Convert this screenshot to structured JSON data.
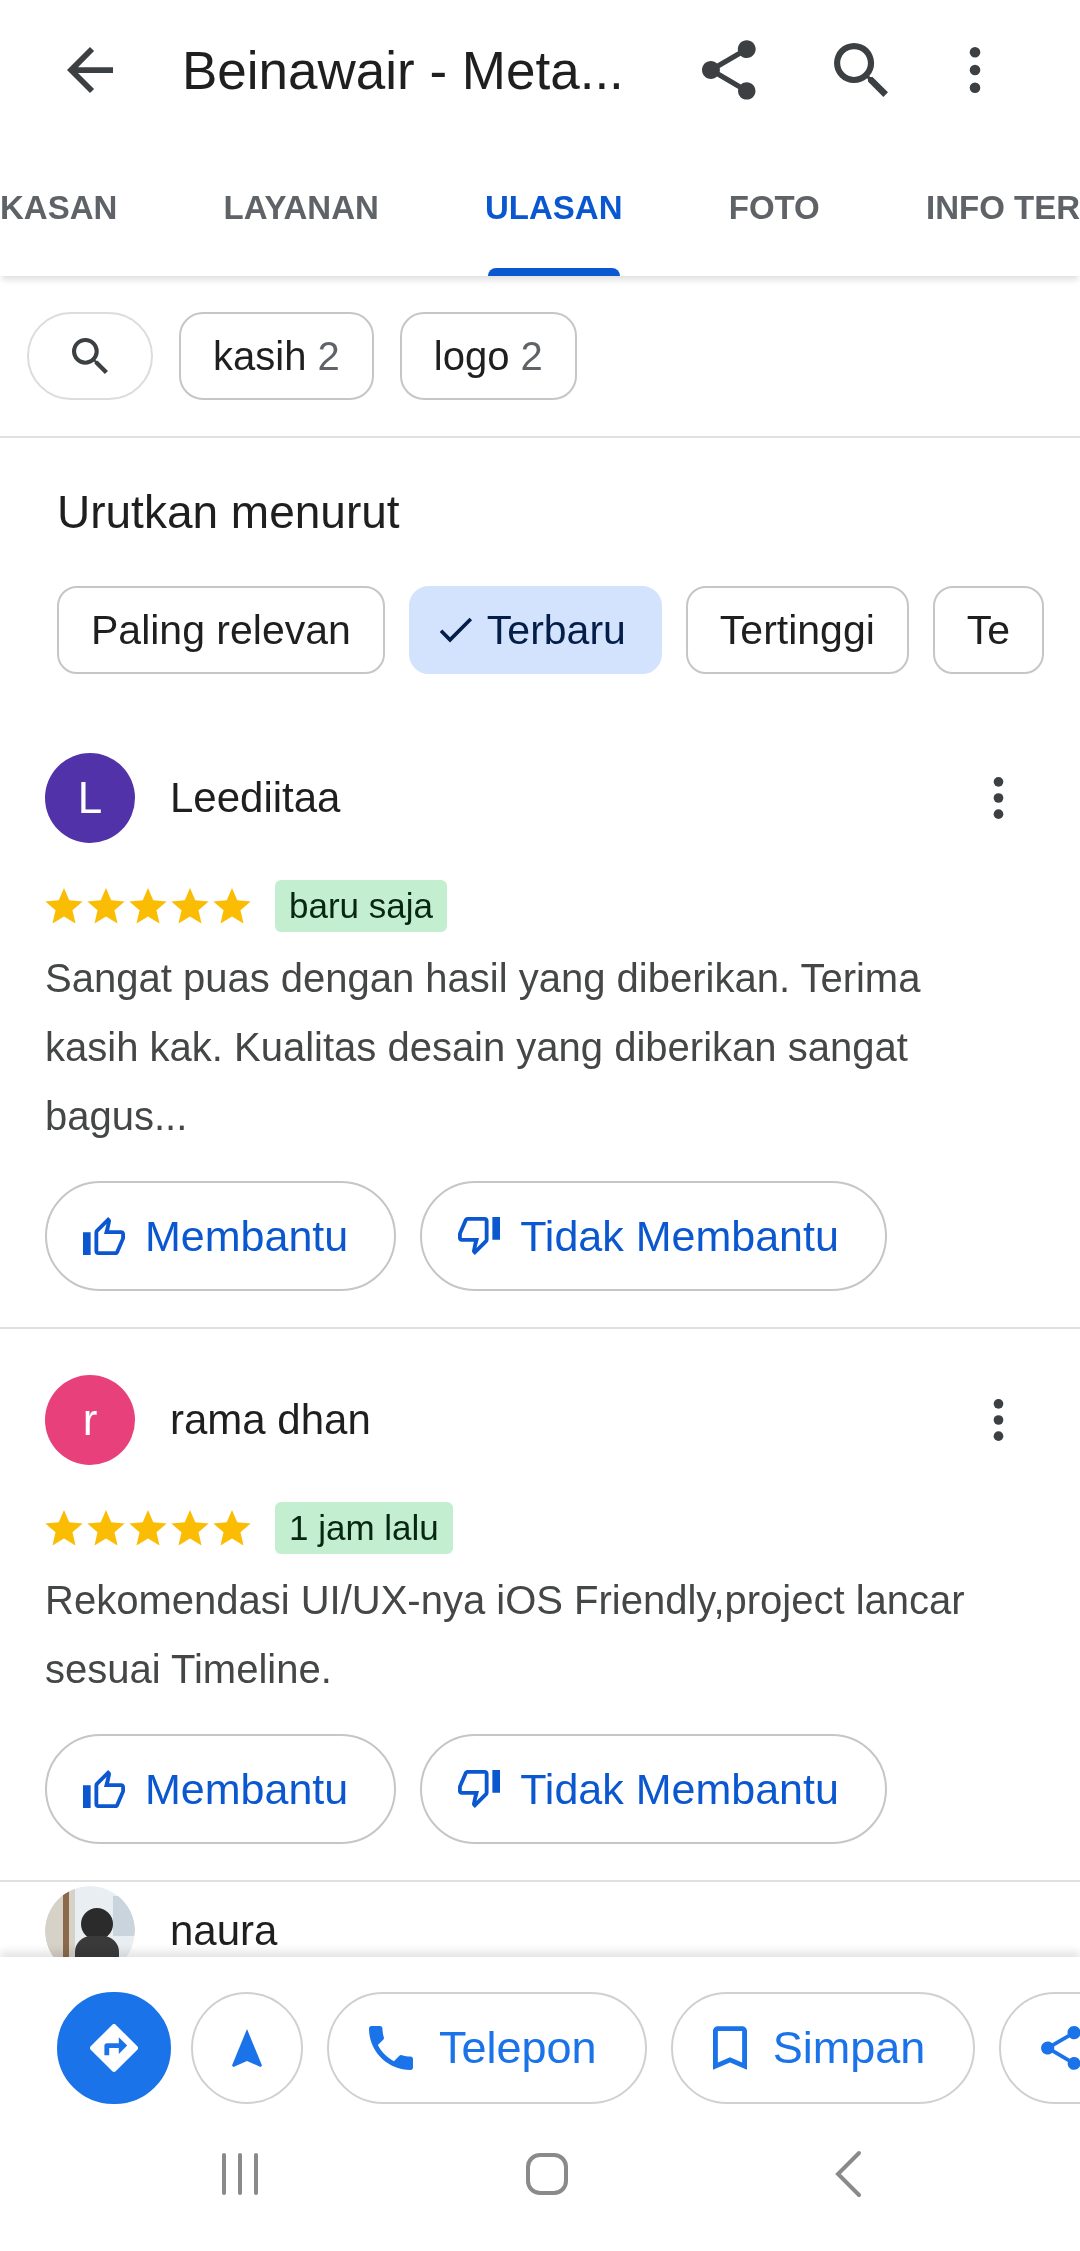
{
  "header": {
    "title": "Beinawair - Meta..."
  },
  "tabs": [
    {
      "label": "KASAN",
      "selected": false
    },
    {
      "label": "LAYANAN",
      "selected": false
    },
    {
      "label": "ULASAN",
      "selected": true
    },
    {
      "label": "FOTO",
      "selected": false
    },
    {
      "label": "INFO TER",
      "selected": false
    }
  ],
  "topic_chips": [
    {
      "label": "kasih",
      "count": "2",
      "selected": false
    },
    {
      "label": "logo",
      "count": "2",
      "selected": false
    }
  ],
  "sort": {
    "title": "Urutkan menurut",
    "options": [
      {
        "label": "Paling relevan",
        "selected": false
      },
      {
        "label": "Terbaru",
        "selected": true
      },
      {
        "label": "Tertinggi",
        "selected": false
      },
      {
        "label": "Te",
        "selected": false
      }
    ]
  },
  "reviews": [
    {
      "name": "Leediitaa",
      "avatar": {
        "kind": "initial",
        "initial": "L",
        "color": "#5232a8"
      },
      "stars": 5,
      "time": "baru saja",
      "text": "Sangat puas dengan hasil yang diberikan. Terima kasih kak. Kualitas desain yang diberikan sangat bagus...",
      "helpful": "Membantu",
      "not_helpful": "Tidak Membantu"
    },
    {
      "name": "rama dhan",
      "avatar": {
        "kind": "initial",
        "initial": "r",
        "color": "#e8407a"
      },
      "stars": 5,
      "time": "1 jam lalu",
      "text": "Rekomendasi UI/UX-nya iOS Friendly,project lancar sesuai Timeline.",
      "helpful": "Membantu",
      "not_helpful": "Tidak Membantu"
    },
    {
      "name": "naura"
    }
  ],
  "actions": [
    {
      "kind": "directions"
    },
    {
      "kind": "start"
    },
    {
      "kind": "call",
      "label": "Telepon"
    },
    {
      "kind": "save",
      "label": "Simpan"
    },
    {
      "kind": "share"
    }
  ]
}
